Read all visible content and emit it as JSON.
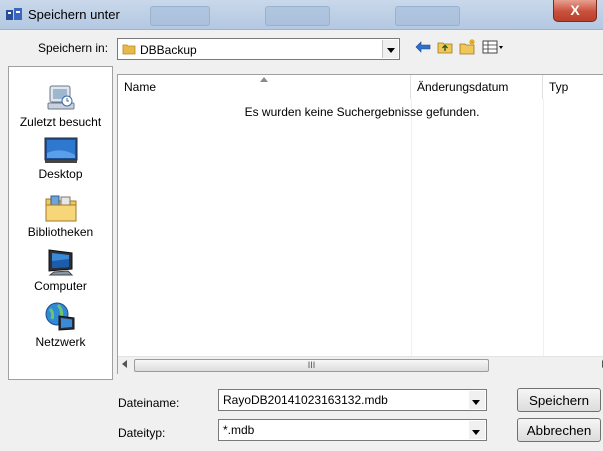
{
  "window": {
    "title": "Speichern unter",
    "close_label": "X"
  },
  "toolbar": {
    "lookin_label": "Speichern in:",
    "lookin_value": "DBBackup",
    "back_icon": "back-arrow-icon",
    "up_icon": "up-folder-icon",
    "new_folder_icon": "new-folder-icon",
    "view_icon": "view-menu-icon"
  },
  "places": [
    {
      "label": "Zuletzt besucht",
      "icon": "recent-places-icon"
    },
    {
      "label": "Desktop",
      "icon": "desktop-icon"
    },
    {
      "label": "Bibliotheken",
      "icon": "libraries-icon"
    },
    {
      "label": "Computer",
      "icon": "computer-icon"
    },
    {
      "label": "Netzwerk",
      "icon": "network-icon"
    }
  ],
  "filelist": {
    "columns": [
      "Name",
      "Änderungsdatum",
      "Typ"
    ],
    "empty_message": "Es wurden keine Suchergebnisse gefunden.",
    "scroll_grip": "III"
  },
  "form": {
    "filename_label": "Dateiname:",
    "filename_value": "RayoDB20141023163132.mdb",
    "filetype_label": "Dateityp:",
    "filetype_value": "*.mdb",
    "save_label": "Speichern",
    "cancel_label": "Abbrechen"
  },
  "colors": {
    "titlebar": "#b4c8e2",
    "close": "#c9503a",
    "folder": "#e8b84a"
  }
}
